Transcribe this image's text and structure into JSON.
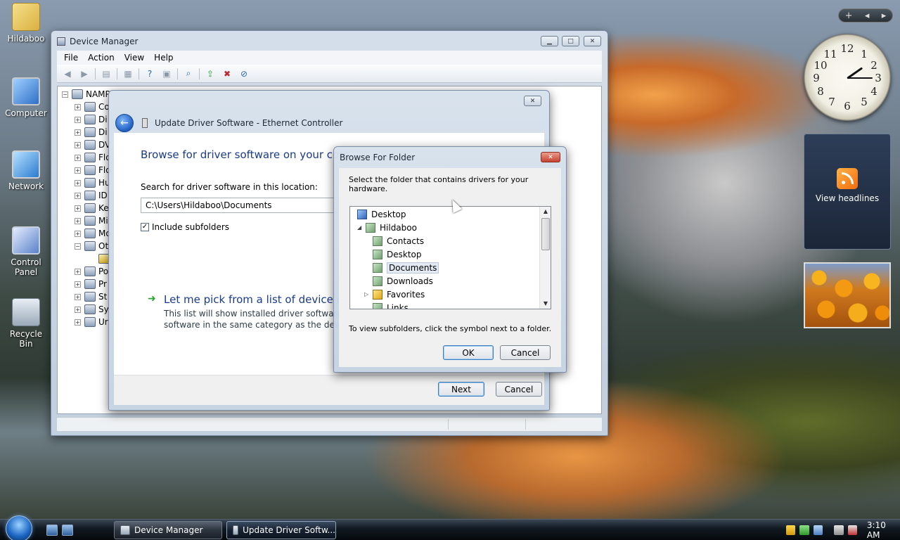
{
  "desktop": {
    "icons": [
      {
        "label": "Hildaboo",
        "icon": "user-folder-icon"
      },
      {
        "label": "Computer",
        "icon": "computer-icon"
      },
      {
        "label": "Network",
        "icon": "network-icon"
      },
      {
        "label": "Control Panel",
        "icon": "control-panel-icon"
      },
      {
        "label": "Recycle Bin",
        "icon": "recycle-bin-icon"
      }
    ]
  },
  "sidebar": {
    "add_label": "+",
    "prev_label": "◂",
    "next_label": "▸",
    "clock_numbers": [
      "12",
      "1",
      "2",
      "3",
      "4",
      "5",
      "6",
      "7",
      "8",
      "9",
      "10",
      "11"
    ],
    "news_label": "View headlines"
  },
  "device_manager": {
    "title": "Device Manager",
    "menu": [
      "File",
      "Action",
      "View",
      "Help"
    ],
    "tree": [
      {
        "expander": "−",
        "label": "NAMP"
      },
      {
        "expander": "+",
        "label": "Co"
      },
      {
        "expander": "+",
        "label": "Di"
      },
      {
        "expander": "+",
        "label": "Di"
      },
      {
        "expander": "+",
        "label": "DV"
      },
      {
        "expander": "+",
        "label": "Flo"
      },
      {
        "expander": "+",
        "label": "Flo"
      },
      {
        "expander": "+",
        "label": "Hu"
      },
      {
        "expander": "+",
        "label": "ID"
      },
      {
        "expander": "+",
        "label": "Ke"
      },
      {
        "expander": "+",
        "label": "Mi"
      },
      {
        "expander": "+",
        "label": "Mo"
      },
      {
        "expander": "−",
        "label": "Ot"
      },
      {
        "expander": "",
        "label": ""
      },
      {
        "expander": "+",
        "label": "Po"
      },
      {
        "expander": "+",
        "label": "Pr"
      },
      {
        "expander": "+",
        "label": "St"
      },
      {
        "expander": "+",
        "label": "Sy"
      },
      {
        "expander": "+",
        "label": "Ur"
      }
    ]
  },
  "wizard": {
    "title": "Update Driver Software - Ethernet Controller",
    "heading": "Browse for driver software on your com",
    "search_label": "Search for driver software in this location:",
    "path_value": "C:\\Users\\Hildaboo\\Documents",
    "include_subfolders_label": "Include subfolders",
    "include_subfolders_checked": "✓",
    "pick_title": "Let me pick from a list of device dri",
    "pick_desc_line1": "This list will show installed driver software cor",
    "pick_desc_line2": "software in the same category as the device.",
    "next_label": "Next",
    "cancel_label": "Cancel"
  },
  "browse": {
    "title": "Browse For Folder",
    "prompt": "Select the folder that contains drivers for your hardware.",
    "tree": [
      {
        "label": "Desktop",
        "indent": 0,
        "toggle": "",
        "icon": "desktop"
      },
      {
        "label": "Hildaboo",
        "indent": 1,
        "toggle": "◢",
        "icon": "user"
      },
      {
        "label": "Contacts",
        "indent": 2,
        "toggle": "",
        "icon": "folder"
      },
      {
        "label": "Desktop",
        "indent": 2,
        "toggle": "",
        "icon": "folder"
      },
      {
        "label": "Documents",
        "indent": 2,
        "toggle": "",
        "icon": "folder",
        "selected": true
      },
      {
        "label": "Downloads",
        "indent": 2,
        "toggle": "",
        "icon": "folder"
      },
      {
        "label": "Favorites",
        "indent": 2,
        "toggle": "▷",
        "icon": "star"
      },
      {
        "label": "Links",
        "indent": 2,
        "toggle": "",
        "icon": "folder"
      }
    ],
    "hint": "To view subfolders, click the symbol next to a folder.",
    "ok_label": "OK",
    "cancel_label": "Cancel"
  },
  "taskbar": {
    "buttons": [
      {
        "label": "Device Manager"
      },
      {
        "label": "Update Driver Softw..."
      }
    ],
    "time": "3:10 AM"
  }
}
